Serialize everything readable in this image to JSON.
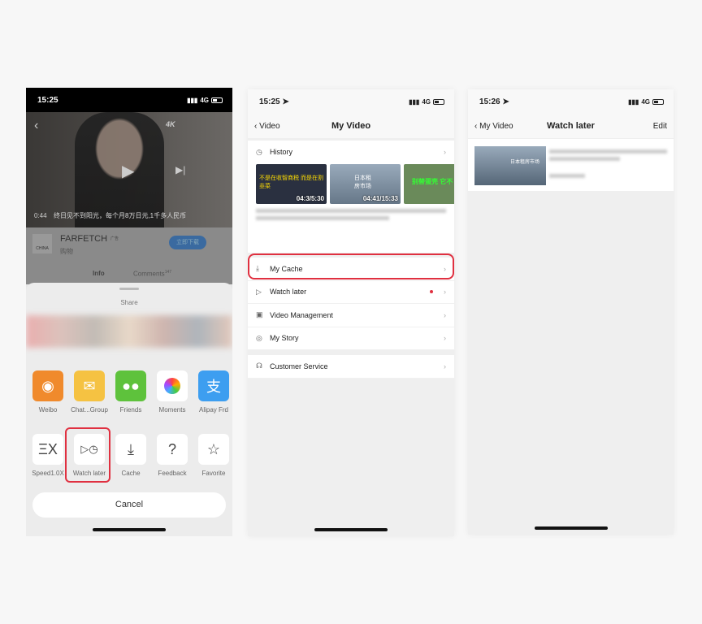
{
  "panel1": {
    "time": "15:25",
    "network": "4G",
    "video_time": "0:44",
    "subtitle": "终日见不到阳光，每个月8万日元,1千多人民币",
    "quality": "4K",
    "ad": {
      "name": "FARFETCH",
      "tag": "广告",
      "category": "购物",
      "button": "立即下载",
      "logo_text": "CHINA"
    },
    "tabs": [
      {
        "label": "Info"
      },
      {
        "label": "Comments",
        "count": "147"
      }
    ],
    "share_title": "Share",
    "share_apps": [
      {
        "label": "Weibo",
        "color": "#f08a2c",
        "icon": "weibo-icon"
      },
      {
        "label": "Chat...Group",
        "color": "#f5c242",
        "icon": "mail-icon"
      },
      {
        "label": "Friends",
        "color": "#5ec23c",
        "icon": "wechat-icon"
      },
      {
        "label": "Moments",
        "color": "#ffffff",
        "icon": "moments-icon"
      },
      {
        "label": "Alipay Frd",
        "color": "#3d9ef0",
        "icon": "alipay-icon"
      }
    ],
    "actions": [
      {
        "label": "Speed1.0X",
        "icon": "speed-icon",
        "glyph": "ΞX"
      },
      {
        "label": "Watch later",
        "icon": "watch-later-icon",
        "glyph": "▷◷"
      },
      {
        "label": "Cache",
        "icon": "download-icon",
        "glyph": "⤓"
      },
      {
        "label": "Feedback",
        "icon": "question-icon",
        "glyph": "?"
      },
      {
        "label": "Favorite",
        "icon": "star-icon",
        "glyph": "☆"
      }
    ],
    "cancel": "Cancel"
  },
  "panel2": {
    "time": "15:25",
    "network": "4G",
    "back": "Video",
    "title": "My Video",
    "history": "History",
    "history_thumbs": [
      {
        "text": "不是在收智商税 而是在割韭菜",
        "duration": "04:3/5:30"
      },
      {
        "text": "日本租房市场",
        "duration": "04:41/15:33"
      },
      {
        "text": "别替蛋壳 它不"
      }
    ],
    "items": [
      {
        "label": "My Cache",
        "icon": "download-icon"
      },
      {
        "label": "Watch later",
        "icon": "watch-later-icon"
      },
      {
        "label": "Video Management",
        "icon": "video-manage-icon"
      },
      {
        "label": "My Story",
        "icon": "story-icon"
      }
    ],
    "service": "Customer Service",
    "accent": "#e03040"
  },
  "panel3": {
    "time": "15:26",
    "network": "4G",
    "back": "My Video",
    "title": "Watch later",
    "edit": "Edit",
    "thumb_text": "日本租房市场"
  }
}
